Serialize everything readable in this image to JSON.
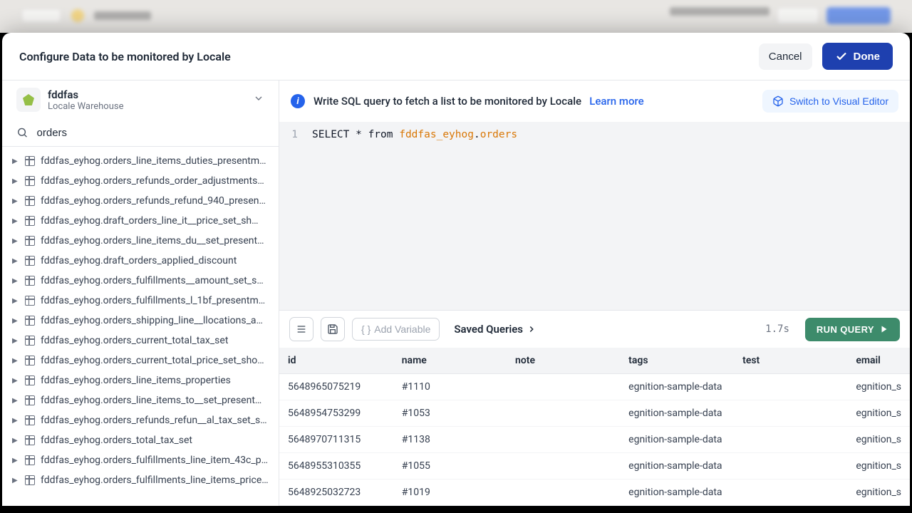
{
  "modal": {
    "title": "Configure Data to be monitored by Locale",
    "cancel": "Cancel",
    "done": "Done"
  },
  "sidebar": {
    "warehouse": {
      "name": "fddfas",
      "subtitle": "Locale Warehouse"
    },
    "search_value": "orders",
    "tables": [
      "fddfas_eyhog.orders_line_items_duties_presentm…",
      "fddfas_eyhog.orders_refunds_order_adjustments…",
      "fddfas_eyhog.orders_refunds_refund_940_presen…",
      "fddfas_eyhog.draft_orders_line_it__price_set_sh…",
      "fddfas_eyhog.orders_line_items_du__set_present…",
      "fddfas_eyhog.draft_orders_applied_discount",
      "fddfas_eyhog.orders_fulfillments__amount_set_s…",
      "fddfas_eyhog.orders_fulfillments_l_1bf_presentme…",
      "fddfas_eyhog.orders_shipping_line__llocations_a…",
      "fddfas_eyhog.orders_current_total_tax_set",
      "fddfas_eyhog.orders_current_total_price_set_sho…",
      "fddfas_eyhog.orders_line_items_properties",
      "fddfas_eyhog.orders_line_items_to__set_present…",
      "fddfas_eyhog.orders_refunds_refun__al_tax_set_s…",
      "fddfas_eyhog.orders_total_tax_set",
      "fddfas_eyhog.orders_fulfillments_line_item_43c_p…",
      "fddfas_eyhog.orders_fulfillments_line_items_price…"
    ]
  },
  "main": {
    "helper": "Write SQL query to fetch a list to be monitored by Locale",
    "learn_more": "Learn more",
    "visual_btn": "Switch to Visual Editor",
    "sql": {
      "line_num": "1",
      "prefix": "SELECT * from ",
      "schema": "fddfas_eyhog",
      "table": "orders"
    },
    "toolbar": {
      "add_variable": "Add Variable",
      "saved_queries": "Saved Queries",
      "timing": "1.7s",
      "run": "RUN QUERY"
    },
    "results": {
      "headers": [
        "id",
        "name",
        "note",
        "tags",
        "test",
        "email"
      ],
      "rows": [
        {
          "id": "5648965075219",
          "name": "#1110",
          "note": "",
          "tags": "egnition-sample-data",
          "test": "",
          "email": "egnition_s"
        },
        {
          "id": "5648954753299",
          "name": "#1053",
          "note": "",
          "tags": "egnition-sample-data",
          "test": "",
          "email": "egnition_s"
        },
        {
          "id": "5648970711315",
          "name": "#1138",
          "note": "",
          "tags": "egnition-sample-data",
          "test": "",
          "email": "egnition_s"
        },
        {
          "id": "5648955310355",
          "name": "#1055",
          "note": "",
          "tags": "egnition-sample-data",
          "test": "",
          "email": "egnition_s"
        },
        {
          "id": "5648925032723",
          "name": "#1019",
          "note": "",
          "tags": "egnition-sample-data",
          "test": "",
          "email": "egnition_s"
        }
      ]
    }
  }
}
